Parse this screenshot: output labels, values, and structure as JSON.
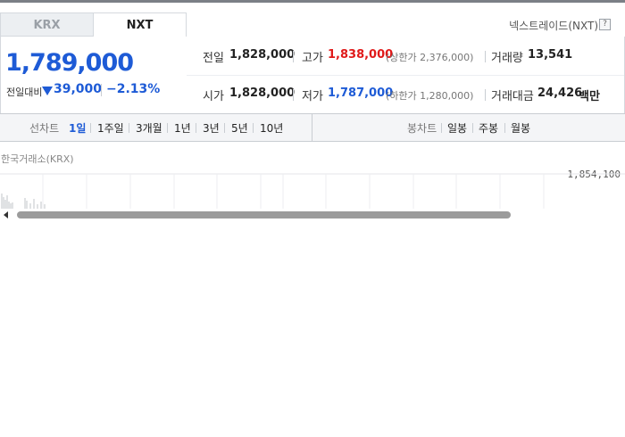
{
  "market_tabs": [
    {
      "label": "KRX",
      "active": false
    },
    {
      "label": "NXT",
      "active": true
    }
  ],
  "venue_label": "넥스트레이드(NXT)",
  "help_icon": "help-icon",
  "price": {
    "current": "1,789,000",
    "prev_label": "전일대비",
    "change": "39,000",
    "change_pct": "−2.13%",
    "direction": "down",
    "color_down": "#1e5bd6",
    "color_up": "#e01a1a"
  },
  "quote": {
    "row1": {
      "prev_label": "전일",
      "prev_value": "1,828,000",
      "high_label": "고가",
      "high_value": "1,838,000",
      "upper_limit": "(상한가 2,376,000)",
      "volume_label": "거래량",
      "volume_value": "13,541"
    },
    "row2": {
      "open_label": "시가",
      "open_value": "1,828,000",
      "low_label": "저가",
      "low_value": "1,787,000",
      "lower_limit": "(하한가 1,280,000)",
      "amount_label": "거래대금",
      "amount_value": "24,426",
      "amount_unit": "백만"
    }
  },
  "line_chart_period": {
    "title": "선차트",
    "items": [
      {
        "label": "1일",
        "active": true
      },
      {
        "label": "1주일",
        "active": false
      },
      {
        "label": "3개월",
        "active": false
      },
      {
        "label": "1년",
        "active": false
      },
      {
        "label": "3년",
        "active": false
      },
      {
        "label": "5년",
        "active": false
      },
      {
        "label": "10년",
        "active": false
      }
    ]
  },
  "candle_chart_period": {
    "title": "봉차트",
    "items": [
      {
        "label": "일봉",
        "active": false
      },
      {
        "label": "주봉",
        "active": false
      },
      {
        "label": "월봉",
        "active": false
      }
    ]
  },
  "chart": {
    "source_label": "한국거래소(KRX)",
    "y_max_label": "1,854,100"
  }
}
